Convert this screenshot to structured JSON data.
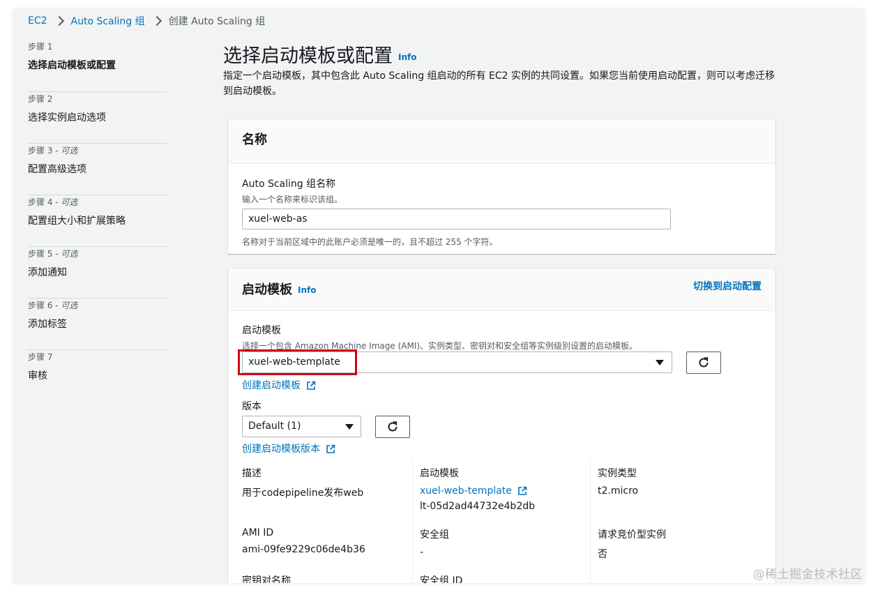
{
  "breadcrumb": {
    "item1": "EC2",
    "item2": "Auto Scaling 组",
    "current": "创建 Auto Scaling 组"
  },
  "steps": [
    {
      "num": "步骤 1",
      "optional": "",
      "label": "选择启动模板或配置"
    },
    {
      "num": "步骤 2",
      "optional": "",
      "label": "选择实例启动选项"
    },
    {
      "num": "步骤 3 - ",
      "optional": "可选",
      "label": "配置高级选项"
    },
    {
      "num": "步骤 4 - ",
      "optional": "可选",
      "label": "配置组大小和扩展策略"
    },
    {
      "num": "步骤 5 - ",
      "optional": "可选",
      "label": "添加通知"
    },
    {
      "num": "步骤 6 - ",
      "optional": "可选",
      "label": "添加标签"
    },
    {
      "num": "步骤 7",
      "optional": "",
      "label": "审核"
    }
  ],
  "page": {
    "title": "选择启动模板或配置",
    "info": "Info",
    "description": "指定一个启动模板，其中包含此 Auto Scaling 组启动的所有 EC2 实例的共同设置。如果您当前使用启动配置，则可以考虑迁移到启动模板。"
  },
  "name_panel": {
    "heading": "名称",
    "label": "Auto Scaling 组名称",
    "desc": "输入一个名称来标识该组。",
    "value": "xuel-web-as",
    "constraint": "名称对于当前区域中的此账户必须是唯一的，且不超过 255 个字符。"
  },
  "lt_panel": {
    "heading": "启动模板",
    "info": "Info",
    "switch_link": "切换到启动配置",
    "template_label": "启动模板",
    "template_desc": "选择一个包含 Amazon Machine Image (AMI)、实例类型、密钥对和安全组等实例级别设置的启动模板。",
    "template_selected": "xuel-web-template",
    "create_template_link": "创建启动模板",
    "version_label": "版本",
    "version_selected": "Default (1)",
    "create_version_link": "创建启动模板版本",
    "details": {
      "desc_label": "描述",
      "desc_value": "用于codepipeline发布web",
      "lt_label": "启动模板",
      "lt_link": "xuel-web-template",
      "lt_id": "lt-05d2ad44732e4b2db",
      "type_label": "实例类型",
      "type_value": "t2.micro",
      "ami_label": "AMI ID",
      "ami_value": "ami-09fe9229c06de4b36",
      "sg_label": "安全组",
      "sg_value": "-",
      "spot_label": "请求竞价型实例",
      "spot_value": "否",
      "key_label": "密钥对名称",
      "sgid_label": "安全组 ID"
    }
  },
  "watermark": "@稀土掘金技术社区",
  "colors": {
    "link": "#0073bb",
    "highlight": "#d0021b",
    "background": "#f2f3f3"
  }
}
